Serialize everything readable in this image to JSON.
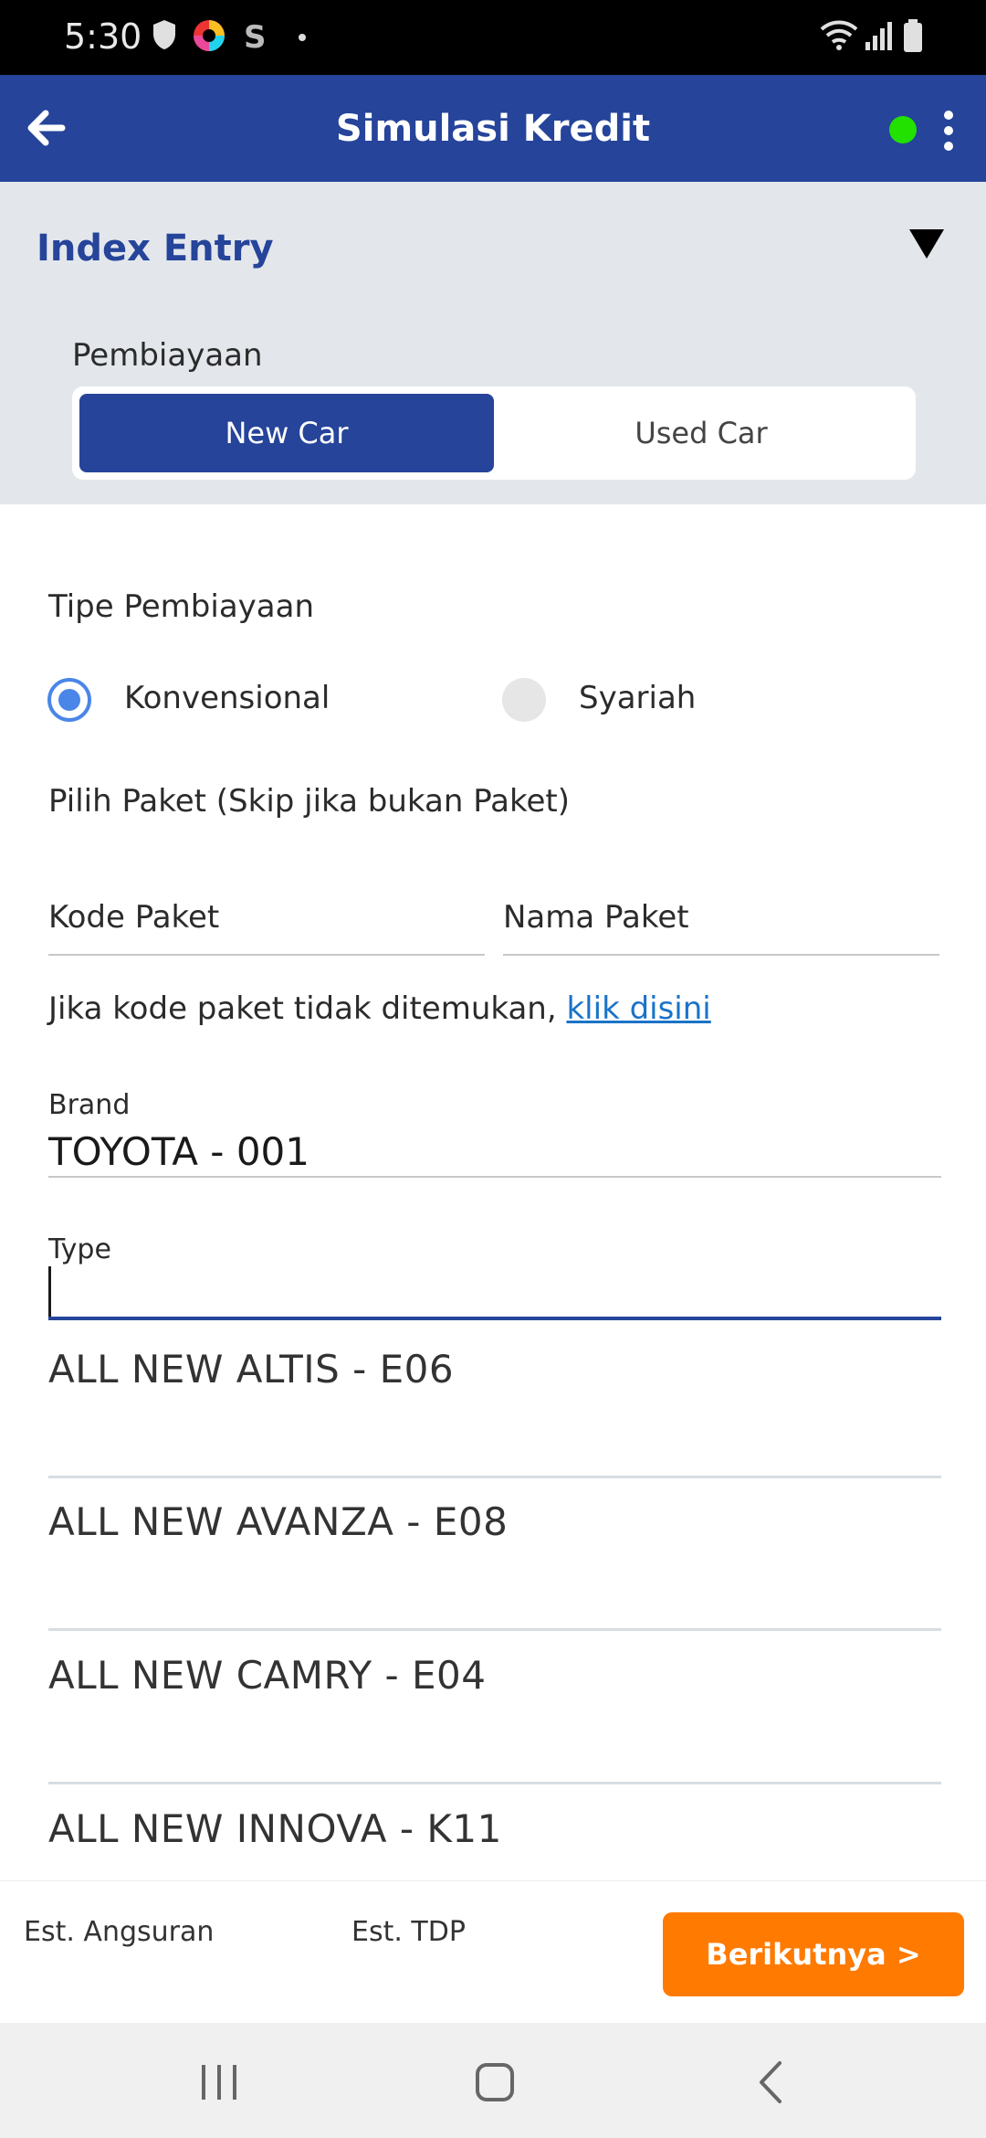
{
  "status_bar": {
    "time": "5:30",
    "left_icons": [
      "shield-icon",
      "color-wheel-icon",
      "s-app-icon",
      "dot-icon"
    ],
    "right_icons": [
      "wifi-icon",
      "signal-icon",
      "battery-icon"
    ]
  },
  "app_bar": {
    "title": "Simulasi Kredit",
    "back_icon": "arrow-left-icon",
    "status_color": "#22e000",
    "menu_icon": "more-vert-icon"
  },
  "index_entry": {
    "title": "Index Entry",
    "pembiayaan_label": "Pembiayaan",
    "options": [
      "New Car",
      "Used Car"
    ],
    "selected": "New Car"
  },
  "form": {
    "tipe_label": "Tipe Pembiayaan",
    "tipe_options": [
      "Konvensional",
      "Syariah"
    ],
    "tipe_selected": "Konvensional",
    "paket_label": "Pilih Paket (Skip jika bukan Paket)",
    "kode_paket_placeholder": "Kode Paket",
    "nama_paket_placeholder": "Nama Paket",
    "hint_text": "Jika kode paket tidak ditemukan, ",
    "hint_link": "klik disini",
    "brand_label": "Brand",
    "brand_value": "TOYOTA - 001",
    "type_label": "Type",
    "type_value": ""
  },
  "type_options": [
    "ALL NEW ALTIS - E06",
    "ALL NEW AVANZA - E08",
    "ALL NEW CAMRY - E04",
    "ALL NEW INNOVA - K11"
  ],
  "bottom_bar": {
    "est_angsuran": "Est. Angsuran",
    "est_tdp": "Est. TDP",
    "next_label": "Berikutnya >",
    "next_color": "#ff7a00"
  },
  "nav_bar": {
    "icons": [
      "recent-apps-icon",
      "home-icon",
      "back-icon"
    ]
  },
  "colors": {
    "primary": "#25449a",
    "accent": "#4a86e8",
    "link": "#1a73c8"
  }
}
